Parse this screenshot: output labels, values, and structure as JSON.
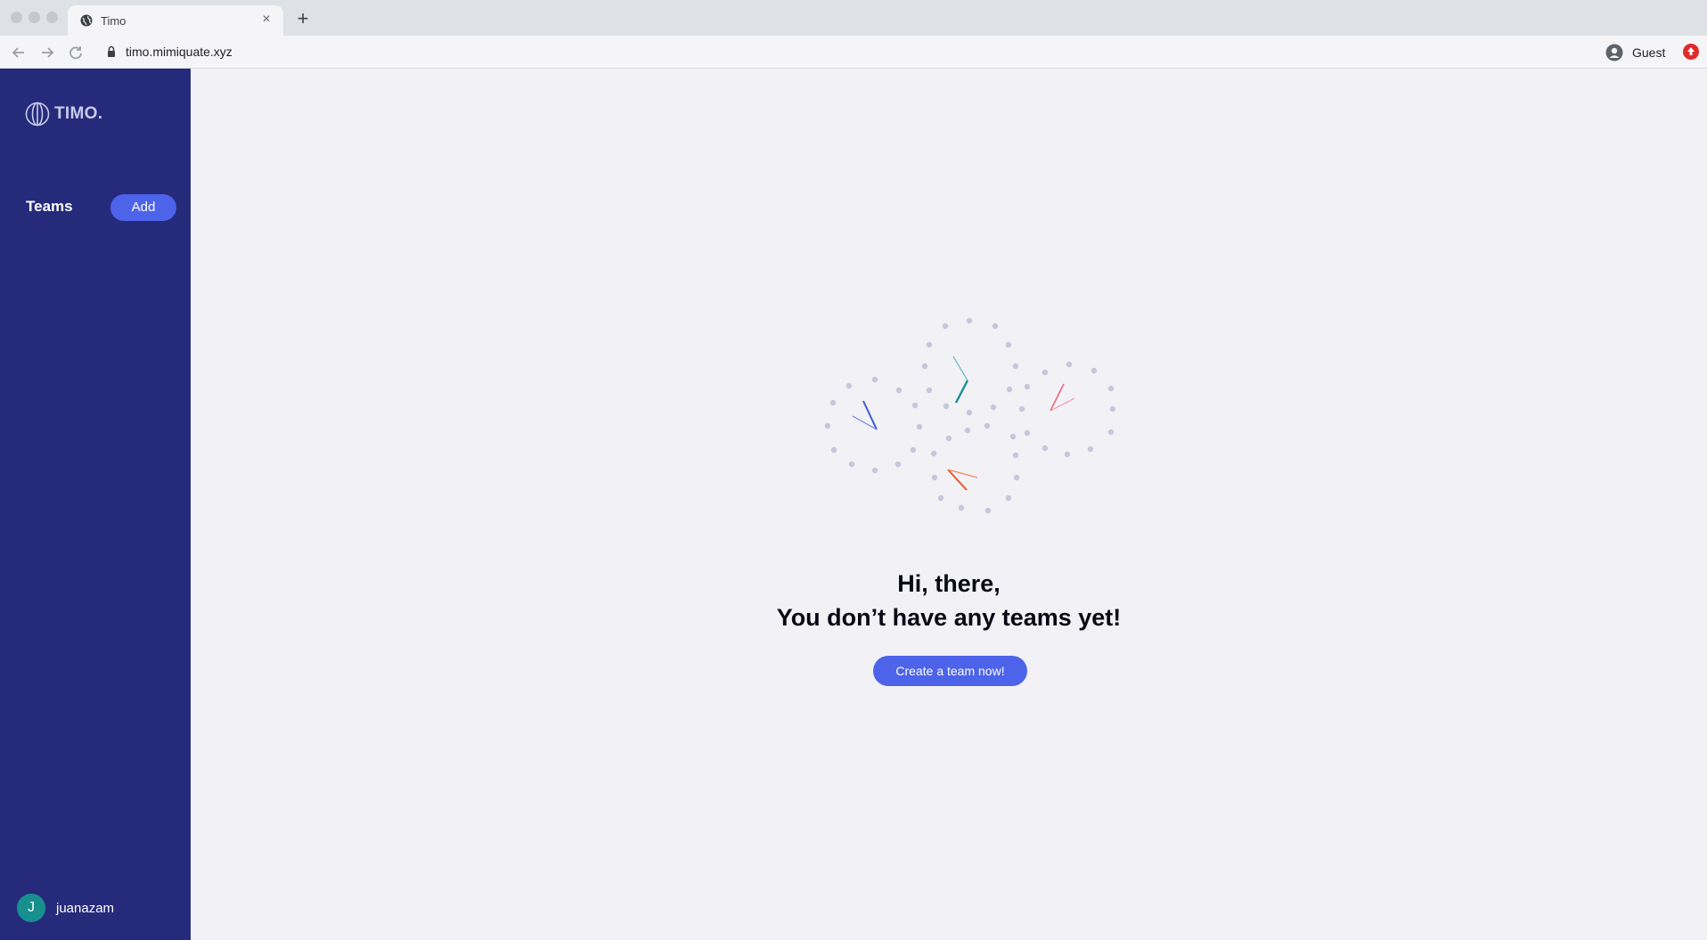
{
  "browser": {
    "tab_title": "Timo",
    "tab_close": "×",
    "new_tab": "+",
    "url": "timo.mimiquate.xyz",
    "profile_label": "Guest"
  },
  "sidebar": {
    "logo_text": "TIMO.",
    "teams_title": "Teams",
    "add_button": "Add",
    "user": {
      "initial": "J",
      "name": "juanazam"
    }
  },
  "main": {
    "heading_line1": "Hi, there,",
    "heading_line2": "You don’t have any teams yet!",
    "cta_button": "Create a team now!"
  },
  "colors": {
    "sidebar_bg": "#252a7b",
    "accent": "#4c63ea",
    "avatar_bg": "#188f8f",
    "page_bg": "#f1f1f6",
    "clock_hands": [
      "#3b5bd6",
      "#1a8f8f",
      "#e86b7d",
      "#e65a2e"
    ]
  },
  "icons": {
    "tab_favicon": "globe-icon",
    "back": "arrow-left-icon",
    "forward": "arrow-right-icon",
    "reload": "reload-icon",
    "lock": "lock-icon",
    "profile": "user-circle-icon",
    "extension": "extension-icon",
    "logo": "globe-icon",
    "illustration": "clocks-illustration"
  }
}
